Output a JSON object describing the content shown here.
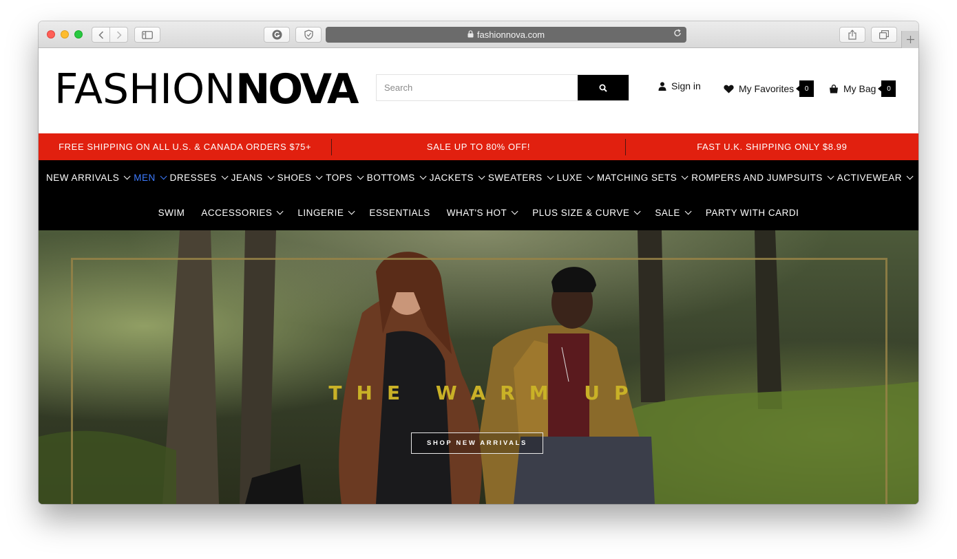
{
  "browser": {
    "url": "fashionnova.com"
  },
  "header": {
    "logo_light": "FASHION",
    "logo_bold": "NOVA",
    "search_placeholder": "Search",
    "sign_in": "Sign in",
    "favorites": "My Favorites",
    "favorites_count": "0",
    "bag": "My Bag",
    "bag_count": "0"
  },
  "promo": [
    "FREE SHIPPING ON ALL U.S. & CANADA ORDERS $75+",
    "SALE UP TO 80% OFF!",
    "FAST U.K. SHIPPING ONLY $8.99"
  ],
  "nav": {
    "row1": [
      {
        "label": "NEW ARRIVALS",
        "dropdown": true
      },
      {
        "label": "MEN",
        "dropdown": true,
        "active": true
      },
      {
        "label": "DRESSES",
        "dropdown": true
      },
      {
        "label": "JEANS",
        "dropdown": true
      },
      {
        "label": "SHOES",
        "dropdown": true
      },
      {
        "label": "TOPS",
        "dropdown": true
      },
      {
        "label": "BOTTOMS",
        "dropdown": true
      },
      {
        "label": "JACKETS",
        "dropdown": true
      },
      {
        "label": "SWEATERS",
        "dropdown": true
      },
      {
        "label": "LUXE",
        "dropdown": true
      },
      {
        "label": "MATCHING SETS",
        "dropdown": true
      },
      {
        "label": "ROMPERS AND JUMPSUITS",
        "dropdown": true
      },
      {
        "label": "ACTIVEWEAR",
        "dropdown": true
      }
    ],
    "row2": [
      {
        "label": "SWIM",
        "dropdown": false
      },
      {
        "label": "ACCESSORIES",
        "dropdown": true
      },
      {
        "label": "LINGERIE",
        "dropdown": true
      },
      {
        "label": "ESSENTIALS",
        "dropdown": false
      },
      {
        "label": "WHAT'S HOT",
        "dropdown": true
      },
      {
        "label": "PLUS SIZE & CURVE",
        "dropdown": true
      },
      {
        "label": "SALE",
        "dropdown": true
      },
      {
        "label": "PARTY WITH CARDI",
        "dropdown": false
      }
    ]
  },
  "hero": {
    "title": "THE WARM UP",
    "cta": "SHOP NEW ARRIVALS"
  },
  "colors": {
    "promo_red": "#e1200f",
    "nav_black": "#000000",
    "active_link": "#3d7bff",
    "hero_title_gold": "#c9b127"
  }
}
